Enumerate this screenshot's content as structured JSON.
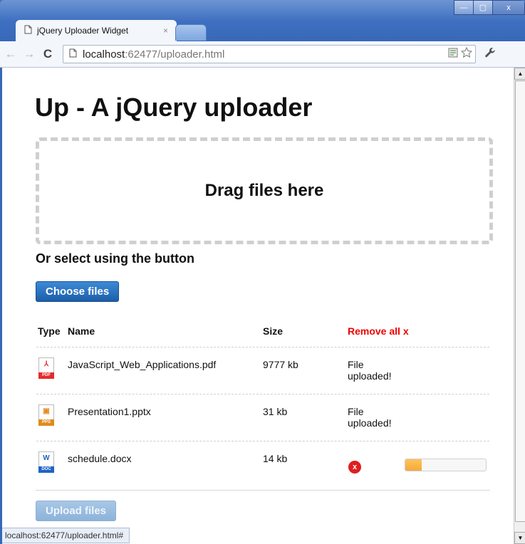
{
  "browser": {
    "tab_title": "jQuery Uploader Widget",
    "tab_close": "×",
    "url_host": "localhost",
    "url_rest": ":62477/uploader.html",
    "win_minimize": "—",
    "win_maximize": "▢",
    "win_close": "x",
    "back_icon": "←",
    "forward_icon": "→",
    "reload_icon": "C",
    "status_url": "localhost:62477/uploader.html#"
  },
  "page": {
    "title": "Up - A jQuery uploader",
    "dropzone_text": "Drag files here",
    "or_select": "Or select using the button",
    "choose_label": "Choose files",
    "upload_label": "Upload files"
  },
  "table": {
    "headers": {
      "type": "Type",
      "name": "Name",
      "size": "Size",
      "remove_all": "Remove all x"
    },
    "rows": [
      {
        "icon": "pdf-icon",
        "icon_glyph": "⅄",
        "icon_tag": "PDF",
        "name": "JavaScript_Web_Applications.pdf",
        "size": "9777 kb",
        "status": "File uploaded!"
      },
      {
        "icon": "pps-icon",
        "icon_glyph": "▣",
        "icon_tag": "PPS",
        "name": "Presentation1.pptx",
        "size": "31 kb",
        "status": "File uploaded!"
      },
      {
        "icon": "doc-icon",
        "icon_glyph": "W",
        "icon_tag": "DOC",
        "name": "schedule.docx",
        "size": "14 kb",
        "status": "",
        "error_glyph": "x",
        "progress": 0.2
      }
    ]
  },
  "colors": {
    "pdf": "#e52a2a",
    "pps": "#e08a1e",
    "doc": "#1f63c4",
    "remove_all": "#e00000",
    "progress": "#f4a93a"
  }
}
